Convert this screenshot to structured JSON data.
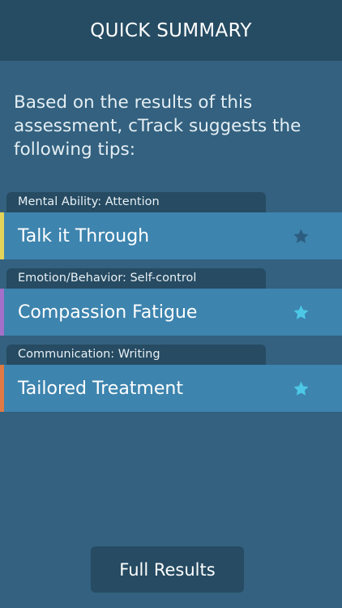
{
  "header": {
    "title": "QUICK SUMMARY"
  },
  "intro": {
    "text": "Based on the results of this assessment, cTrack suggests the following tips:"
  },
  "tips": [
    {
      "category": "Mental Ability: Attention",
      "title": "Talk it Through",
      "accent_color": "#e4d35a",
      "starred": false,
      "star_color": "#2c5d80",
      "icon": "star-icon"
    },
    {
      "category": "Emotion/Behavior: Self-control",
      "title": "Compassion Fatigue",
      "accent_color": "#a46fc9",
      "starred": true,
      "star_color": "#4cc8e6",
      "icon": "star-icon"
    },
    {
      "category": "Communication: Writing",
      "title": "Tailored Treatment",
      "accent_color": "#e07a45",
      "starred": true,
      "star_color": "#4cc8e6",
      "icon": "star-icon"
    }
  ],
  "footer": {
    "full_results_label": "Full Results"
  },
  "colors": {
    "background": "#33617f",
    "header": "#264c63",
    "card": "#3d84ae"
  }
}
